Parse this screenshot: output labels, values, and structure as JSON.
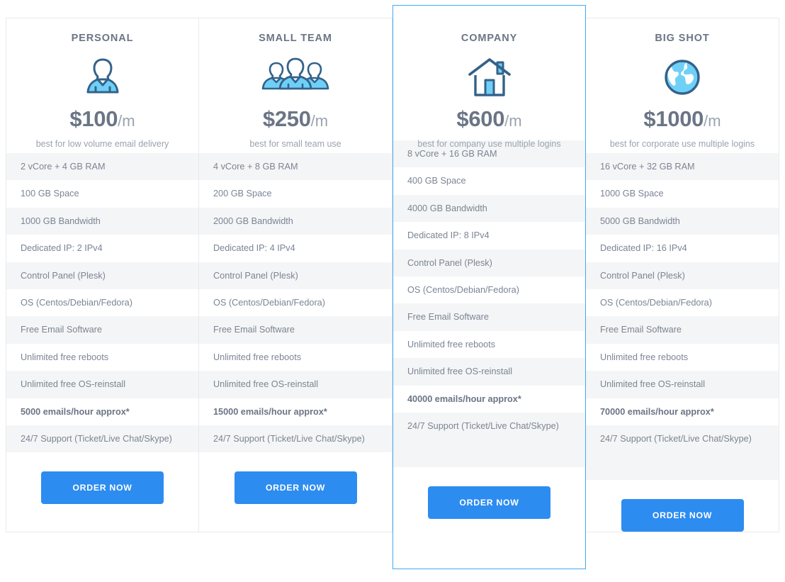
{
  "theme": {
    "accent": "#2d8cf0",
    "featured_border": "#3faaf7",
    "text": "#7b8594",
    "heading": "#6b7585",
    "muted": "#9aa3af",
    "row_stripe": "#f4f5f6",
    "border": "#e9eaec"
  },
  "plans": [
    {
      "title": "PERSONAL",
      "icon": "single-user-icon",
      "price_amount": "$100",
      "price_period": "/m",
      "tagline": "best for low volume email delivery",
      "featured": false,
      "features": [
        "2 vCore + 4 GB RAM",
        "100 GB Space",
        "1000 GB Bandwidth",
        "Dedicated IP: 2 IPv4",
        "Control Panel (Plesk)",
        "OS (Centos/Debian/Fedora)",
        "Free Email Software",
        "Unlimited free reboots",
        "Unlimited free OS-reinstall",
        "5000 emails/hour approx*",
        "24/7  Support (Ticket/Live Chat/Skype)"
      ],
      "button_label": "ORDER NOW"
    },
    {
      "title": "SMALL TEAM",
      "icon": "group-of-users-icon",
      "price_amount": "$250",
      "price_period": "/m",
      "tagline": "best for small team use",
      "featured": false,
      "features": [
        "4 vCore + 8 GB RAM",
        "200 GB Space",
        "2000 GB Bandwidth",
        "Dedicated IP: 4 IPv4",
        "Control Panel (Plesk)",
        "OS (Centos/Debian/Fedora)",
        "Free Email Software",
        "Unlimited free reboots",
        "Unlimited free OS-reinstall",
        "15000 emails/hour approx*",
        "24/7  Support (Ticket/Live Chat/Skype)"
      ],
      "button_label": "ORDER NOW"
    },
    {
      "title": "COMPANY",
      "icon": "house-icon",
      "price_amount": "$600",
      "price_period": "/m",
      "tagline": "best for company use multiple logins",
      "featured": true,
      "features": [
        "8 vCore + 16 GB RAM",
        "400 GB Space",
        "4000 GB Bandwidth",
        "Dedicated IP: 8 IPv4",
        "Control Panel (Plesk)",
        "OS (Centos/Debian/Fedora)",
        "Free Email Software",
        "Unlimited free reboots",
        "Unlimited free OS-reinstall",
        "40000 emails/hour approx*",
        "24/7  Support (Ticket/Live Chat/Skype)"
      ],
      "button_label": "ORDER NOW"
    },
    {
      "title": "BIG SHOT",
      "icon": "globe-icon",
      "price_amount": "$1000",
      "price_period": "/m",
      "tagline": "best for corporate use multiple logins",
      "featured": false,
      "features": [
        "16 vCore + 32 GB RAM",
        "1000 GB Space",
        "5000 GB Bandwidth",
        "Dedicated IP: 16 IPv4",
        "Control Panel (Plesk)",
        "OS (Centos/Debian/Fedora)",
        "Free Email Software",
        "Unlimited free reboots",
        "Unlimited free OS-reinstall",
        "70000 emails/hour approx*",
        "24/7  Support (Ticket/Live Chat/Skype)"
      ],
      "button_label": "ORDER NOW"
    }
  ]
}
